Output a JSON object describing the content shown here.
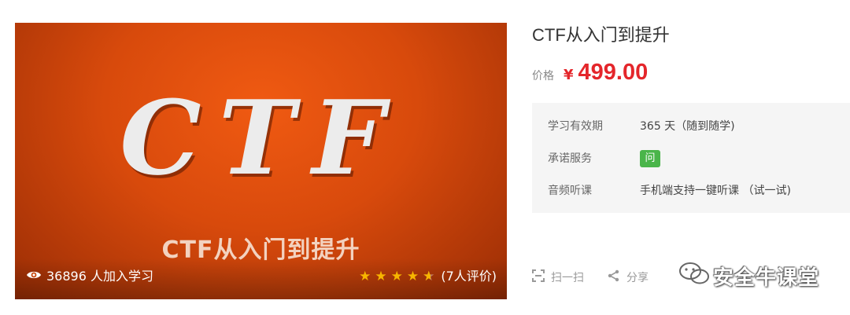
{
  "cover": {
    "logo_text": "CTF",
    "subtitle": "CTF从入门到提升",
    "learners_count": "36896",
    "learners_suffix": " 人加入学习",
    "rating_stars": 4.5,
    "rating_text": "(7人评价)",
    "star_color": "#f7b500",
    "background_color": "#e0500e"
  },
  "course": {
    "title": "CTF从入门到提升",
    "price_label": "价格",
    "currency": "¥",
    "price": "499.00",
    "price_color": "#e4262b"
  },
  "details": [
    {
      "label": "学习有效期",
      "value": "365 天（随到随学)"
    },
    {
      "label": "承诺服务",
      "value": "问",
      "badge_color": "#4ab54a"
    },
    {
      "label": "音频听课",
      "value": "手机端支持一键听课 （试一试)"
    }
  ],
  "actions": {
    "scan_label": "扫一扫",
    "share_label": "分享"
  },
  "watermark": {
    "text": "安全牛课堂"
  }
}
